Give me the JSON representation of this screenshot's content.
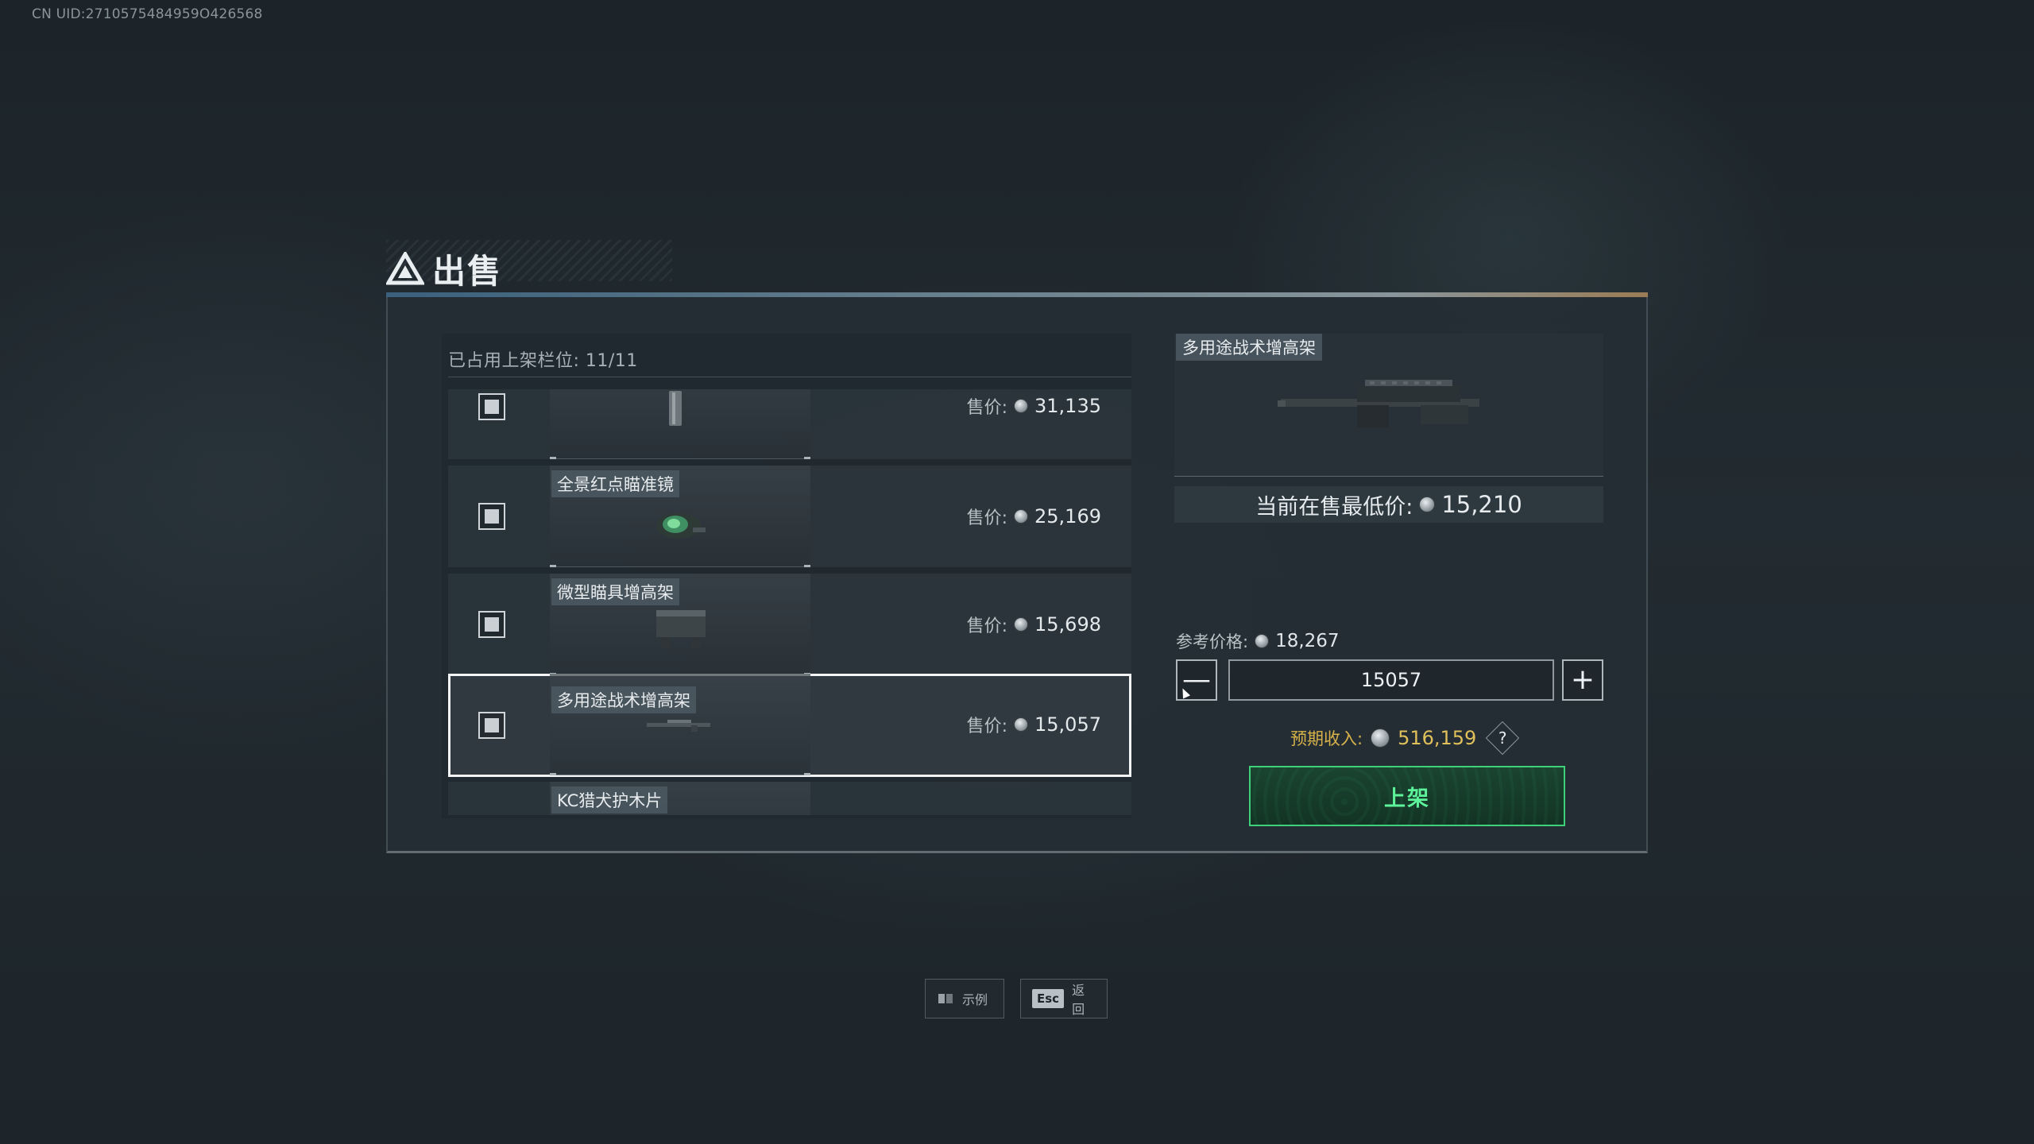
{
  "uid": "CN UID:2710575484959O426568",
  "dialog": {
    "title": "出售",
    "icon": "triangle-logo-icon"
  },
  "listing": {
    "slots_text": "已占用上架栏位: 11/11",
    "price_label": "售价:",
    "items": [
      {
        "name": "",
        "price": "31,135",
        "selected": false
      },
      {
        "name": "全景红点瞄准镜",
        "price": "25,169",
        "selected": false
      },
      {
        "name": "微型瞄具增高架",
        "price": "15,698",
        "selected": false
      },
      {
        "name": "多用途战术增高架",
        "price": "15,057",
        "selected": true
      },
      {
        "name": "KC猎犬护木片",
        "price": "",
        "selected": false
      }
    ]
  },
  "detail": {
    "item_name": "多用途战术增高架",
    "lowest_label": "当前在售最低价:",
    "lowest_price": "15,210",
    "ref_label": "参考价格:",
    "ref_price": "18,267",
    "input_value": "15057",
    "minus_symbol": "—",
    "plus_symbol": "+",
    "income_label": "预期收入:",
    "income_value": "516,159",
    "help_symbol": "?",
    "list_button": "上架"
  },
  "hints": {
    "example_label": "示例",
    "back_key": "Esc",
    "back_label": "返回"
  },
  "colors": {
    "accent_green": "#3fd17a",
    "income_gold": "#e0c05a",
    "selected_outline": "#f2f4f5"
  }
}
